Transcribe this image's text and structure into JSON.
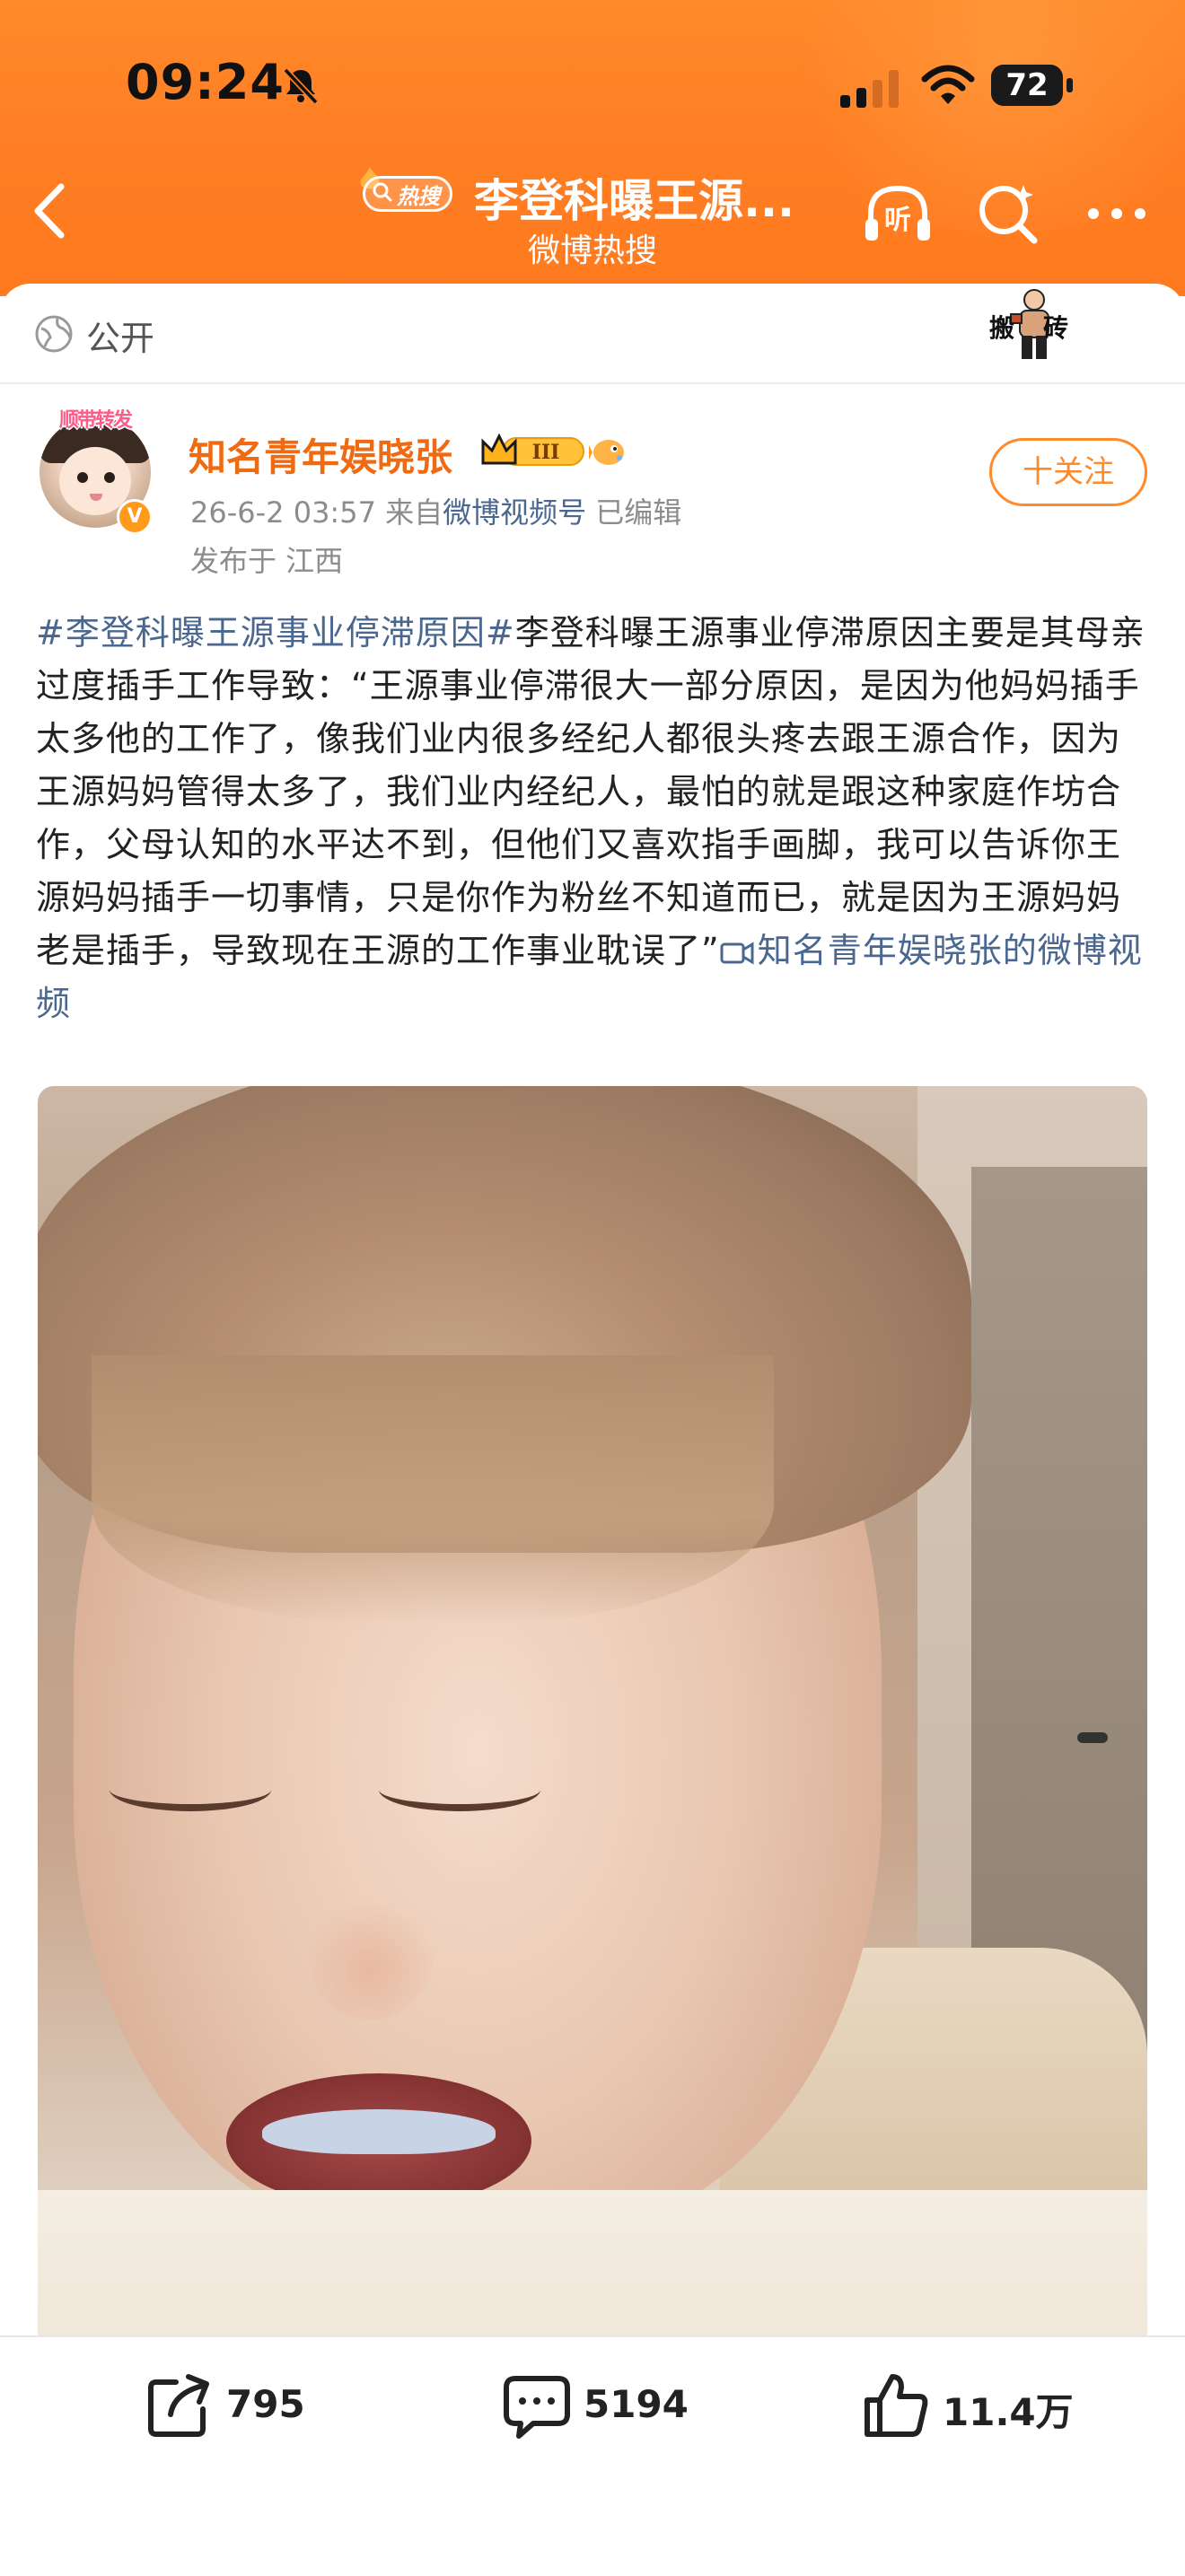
{
  "status_bar": {
    "time": "09:24",
    "battery": "72",
    "battery_level": 0.72
  },
  "nav": {
    "hot_badge": "热搜",
    "title": "李登科曝王源...",
    "subtitle": "微博热搜"
  },
  "visibility": {
    "label": "公开"
  },
  "sticker": {
    "text1": "搬",
    "text2": "砖"
  },
  "author": {
    "avatar_banner": "顺带转发",
    "name": "知名青年娱晓张",
    "level": "III",
    "verified_mark": "V",
    "time": "26-6-2 03:57",
    "source_prefix": "来自",
    "source": "微博视频号",
    "edited": "已编辑",
    "location": "发布于 江西"
  },
  "follow_button": {
    "label": "十关注"
  },
  "post": {
    "hashtag": "#李登科曝王源事业停滞原因#",
    "body": "李登科曝王源事业停滞原因主要是其母亲过度插手工作导致：“王源事业停滞很大一部分原因，是因为他妈妈插手太多他的工作了，像我们业内很多经纪人都很头疼去跟王源合作，因为王源妈妈管得太多了，我们业内经纪人，最怕的就是跟这种家庭作坊合作，父母认知的水平达不到，但他们又喜欢指手画脚，我可以告诉你王源妈妈插手一切事情，只是你作为粉丝不知道而已，就是因为王源妈妈老是插手，导致现在王源的工作事业耽误了”",
    "video_link": "知名青年娱晓张的微博视频"
  },
  "actions": {
    "share_count": "795",
    "comment_count": "5194",
    "like_count": "11.4万"
  },
  "colors": {
    "header": "#ff7f24",
    "author_name": "#f06a12",
    "link": "#4a6790",
    "follow": "#ff8a2a"
  }
}
